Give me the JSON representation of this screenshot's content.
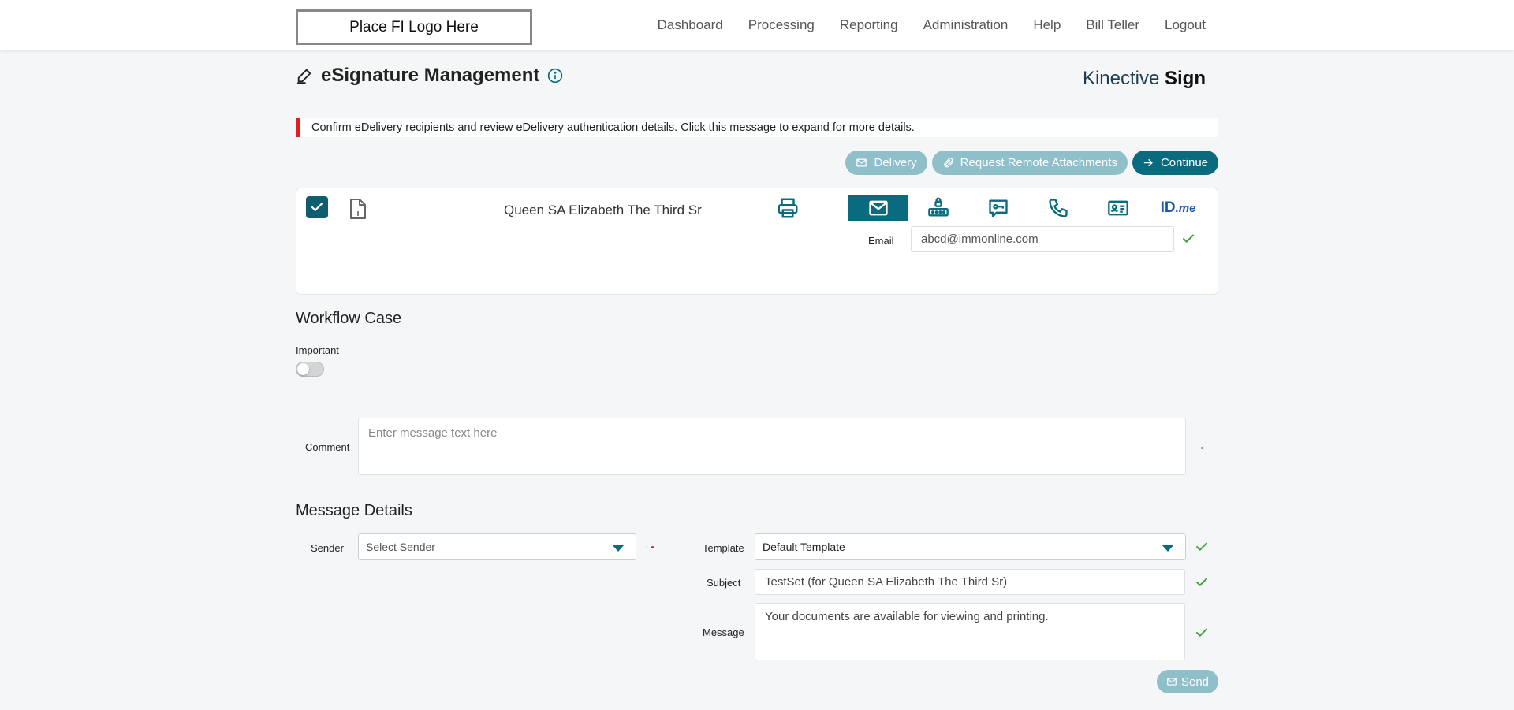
{
  "header": {
    "logo_text": "Place FI Logo Here",
    "nav": [
      "Dashboard",
      "Processing",
      "Reporting",
      "Administration",
      "Help",
      "Bill Teller",
      "Logout"
    ]
  },
  "page": {
    "title": "eSignature Management",
    "brand_light": "Kinective ",
    "brand_bold": "Sign"
  },
  "alert": {
    "text": "Confirm eDelivery recipients and review eDelivery authentication details. Click this message to expand for more details.",
    "color": "#e41c1c"
  },
  "actions": {
    "delivery": "Delivery",
    "request_attachments": "Request Remote Attachments",
    "continue": "Continue"
  },
  "recipient": {
    "name": "Queen SA Elizabeth The Third Sr",
    "checked": true,
    "method_icons": [
      "envelope-icon",
      "router-icon",
      "chat-key-icon",
      "phone-icon",
      "id-card-icon",
      "idme-logo"
    ],
    "active_method": "envelope-icon",
    "idme_main": "ID",
    "idme_suffix": ".me",
    "email_label": "Email",
    "email_value": "abcd@immonline.com"
  },
  "workflow": {
    "title": "Workflow Case",
    "important_label": "Important",
    "important_on": false,
    "comment_label": "Comment",
    "comment_placeholder": "Enter message text here"
  },
  "message": {
    "title": "Message Details",
    "sender_label": "Sender",
    "sender_value": "Select Sender",
    "template_label": "Template",
    "template_value": "Default Template",
    "subject_label": "Subject",
    "subject_value": "TestSet (for Queen SA Elizabeth The Third Sr)",
    "message_label": "Message",
    "message_value": "Your documents are available for viewing and printing.",
    "send": "Send"
  },
  "colors": {
    "accent": "#0b6b7e",
    "accent_disabled": "#8fbfc9",
    "valid_check": "#3fa535",
    "required_dot": "#e41c1c"
  }
}
